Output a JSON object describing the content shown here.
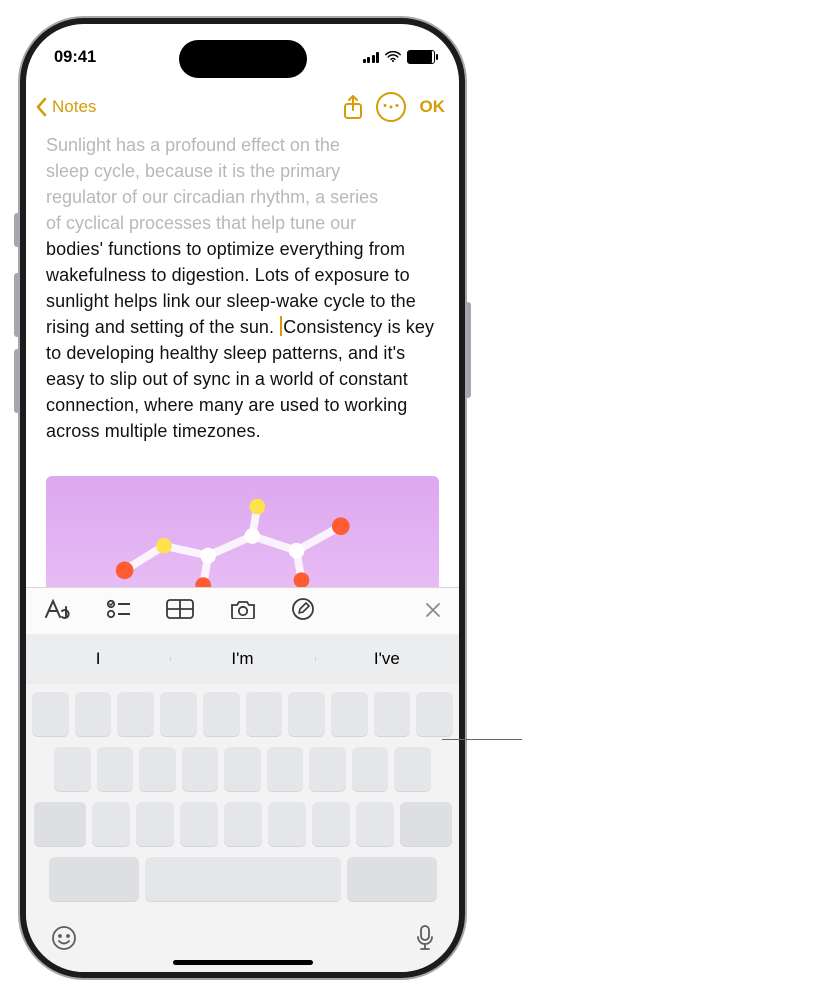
{
  "status": {
    "time": "09:41"
  },
  "nav": {
    "back_label": "Notes",
    "ok_label": "OK"
  },
  "note": {
    "faded_line1": "Sunlight has a profound effect on the",
    "faded_line2": "sleep cycle, because it is the primary",
    "faded_line3": "regulator of our circadian rhythm, a series",
    "faded_line4": "of cyclical processes that help tune our",
    "body_before_cursor": "bodies' functions to optimize everything from wakefulness to digestion. Lots of exposure to sunlight helps link our sleep-wake cycle to the rising and setting of the sun. ",
    "body_after_cursor": "Consistency is key to developing healthy sleep patterns, and it's easy to slip out of sync in a world of constant connection, where many are used to working across multiple timezones."
  },
  "predictions": {
    "slot1": "I",
    "slot2": "I'm",
    "slot3": "I've"
  },
  "icons": {
    "back": "chevron-left-icon",
    "share": "share-icon",
    "more": "more-circle-icon",
    "text_format": "text-format-icon",
    "checklist": "checklist-icon",
    "table": "table-icon",
    "camera": "camera-icon",
    "markup": "markup-pen-icon",
    "close": "close-icon",
    "emoji": "emoji-icon",
    "mic": "microphone-icon"
  },
  "colors": {
    "accent": "#d59c08"
  }
}
